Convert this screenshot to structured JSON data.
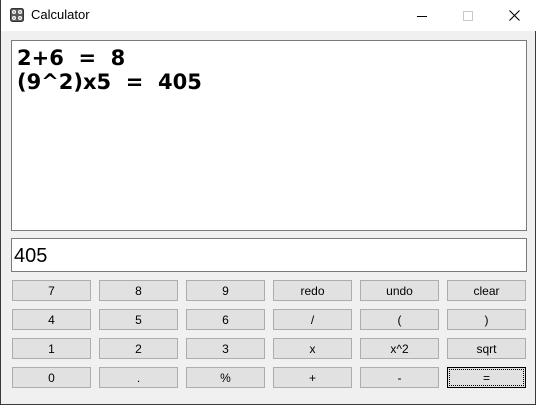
{
  "window": {
    "title": "Calculator"
  },
  "history": [
    "2+6  =  8",
    "(9^2)x5  =  405"
  ],
  "display": {
    "value": "405"
  },
  "keys": [
    [
      "7",
      "8",
      "9",
      "redo",
      "undo",
      "clear"
    ],
    [
      "4",
      "5",
      "6",
      "/",
      "(",
      ")"
    ],
    [
      "1",
      "2",
      "3",
      "x",
      "x^2",
      "sqrt"
    ],
    [
      "0",
      ".",
      "%",
      "+",
      "-",
      "="
    ]
  ]
}
